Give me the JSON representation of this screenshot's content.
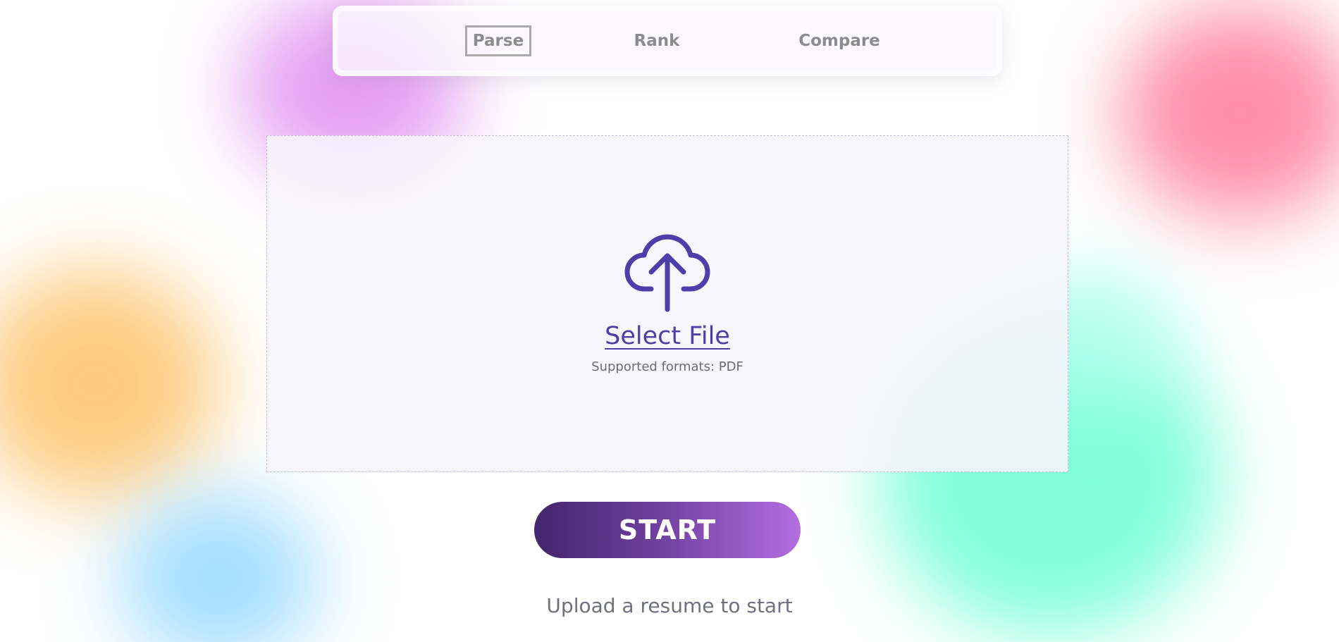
{
  "nav": {
    "items": [
      {
        "label": "Parse",
        "active": true
      },
      {
        "label": "Rank",
        "active": false
      },
      {
        "label": "Compare",
        "active": false
      }
    ]
  },
  "upload": {
    "icon": "cloud-upload-icon",
    "select_label": "Select File",
    "formats_text": "Supported formats: PDF"
  },
  "start_button": {
    "label": "START"
  },
  "hint": "Upload a resume to start",
  "colors": {
    "accent": "#4d3eaa",
    "button_gradient_start": "#42266b",
    "button_gradient_end": "#b36ee0",
    "nav_text": "#8c8c8c"
  }
}
